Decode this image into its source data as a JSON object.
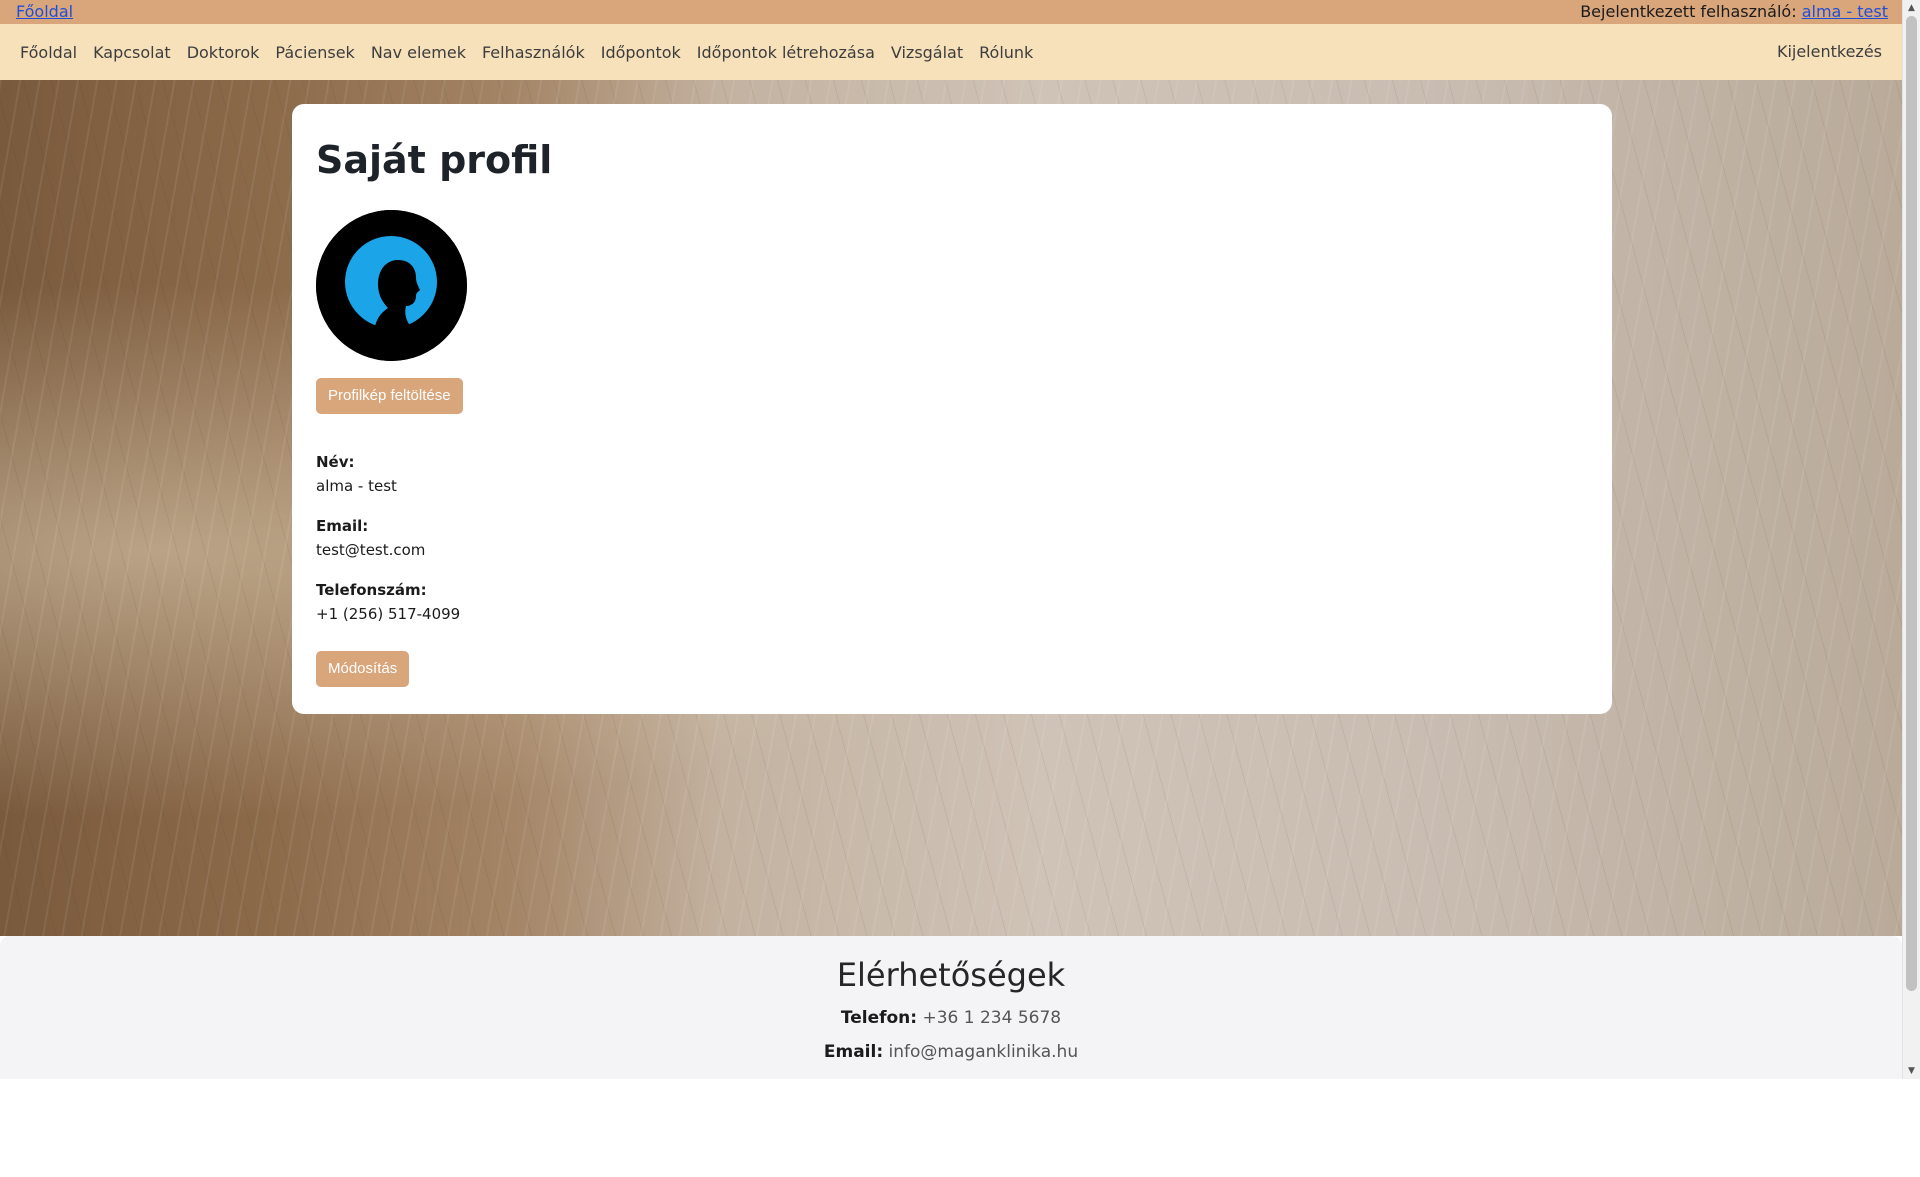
{
  "topbar": {
    "home_link": "Főoldal",
    "login_label": "Bejelentkezett felhasználó: ",
    "user_link": "alma - test"
  },
  "nav": {
    "items": [
      "Főoldal",
      "Kapcsolat",
      "Doktorok",
      "Páciensek",
      "Nav elemek",
      "Felhasználók",
      "Időpontok",
      "Időpontok létrehozása",
      "Vizsgálat",
      "Rólunk"
    ],
    "logout": "Kijelentkezés"
  },
  "profile": {
    "title": "Saját profil",
    "upload_button": "Profilkép feltöltése",
    "name_label": "Név:",
    "name_value": "alma - test",
    "email_label": "Email:",
    "email_value": "test@test.com",
    "phone_label": "Telefonszám:",
    "phone_value": "+1 (256) 517-4099",
    "edit_button": "Módosítás"
  },
  "footer": {
    "title": "Elérhetőségek",
    "phone_label": "Telefon:",
    "phone_value": "+36 1 234 5678",
    "email_label": "Email:",
    "email_value": "info@maganklinika.hu"
  },
  "colors": {
    "topbar": "#d9a57a",
    "navbar": "#f7e1bb",
    "button": "#d9a57a",
    "link": "#1f4fd6",
    "footer": "#f4f4f7"
  }
}
